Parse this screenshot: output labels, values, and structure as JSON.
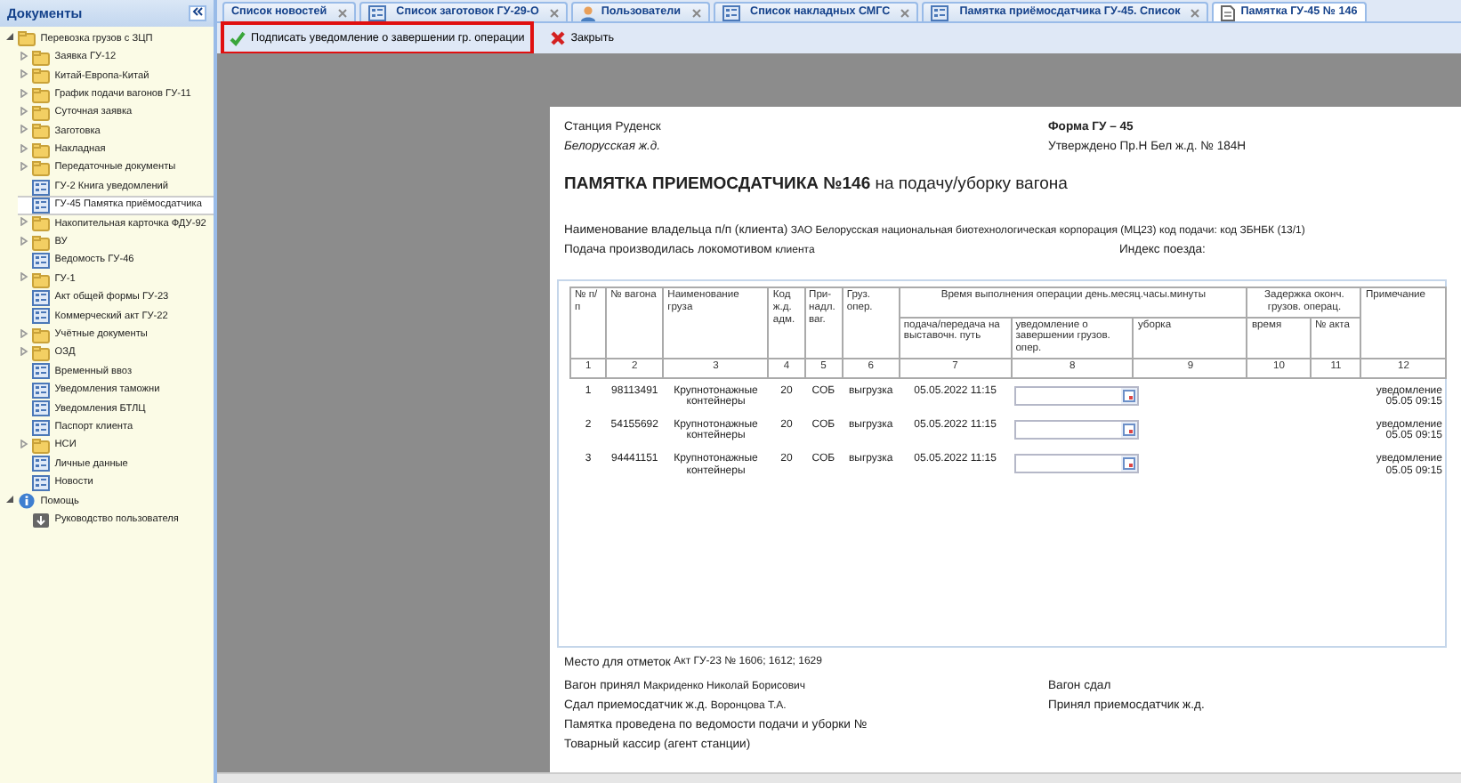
{
  "sidebar": {
    "title": "Документы",
    "items": [
      {
        "label": "Перевозка грузов с ЗЦП",
        "kind": "folder",
        "expanded": true,
        "selected": false,
        "children": [
          {
            "label": "Заявка ГУ-12",
            "kind": "folder",
            "expanded": false,
            "selected": false
          },
          {
            "label": "Китай-Европа-Китай",
            "kind": "folder",
            "expanded": false,
            "selected": false
          },
          {
            "label": "График подачи вагонов ГУ-11",
            "kind": "folder",
            "expanded": false,
            "selected": false
          },
          {
            "label": "Суточная заявка",
            "kind": "folder",
            "expanded": false,
            "selected": false
          },
          {
            "label": "Заготовка",
            "kind": "folder",
            "expanded": false,
            "selected": false
          },
          {
            "label": "Накладная",
            "kind": "folder",
            "expanded": false,
            "selected": false
          },
          {
            "label": "Передаточные документы",
            "kind": "folder",
            "expanded": false,
            "selected": false
          },
          {
            "label": "ГУ-2 Книга уведомлений",
            "kind": "document",
            "selected": false
          },
          {
            "label": "ГУ-45 Памятка приёмосдатчика",
            "kind": "document",
            "selected": true
          },
          {
            "label": "Накопительная карточка ФДУ-92",
            "kind": "folder",
            "expanded": false,
            "selected": false
          },
          {
            "label": "ВУ",
            "kind": "folder",
            "expanded": false,
            "selected": false
          },
          {
            "label": "Ведомость ГУ-46",
            "kind": "document",
            "selected": false
          },
          {
            "label": "ГУ-1",
            "kind": "folder",
            "expanded": false,
            "selected": false
          },
          {
            "label": "Акт общей формы ГУ-23",
            "kind": "document",
            "selected": false
          },
          {
            "label": "Коммерческий акт ГУ-22",
            "kind": "document",
            "selected": false
          },
          {
            "label": "Учётные документы",
            "kind": "folder",
            "expanded": false,
            "selected": false
          },
          {
            "label": "ОЗД",
            "kind": "folder",
            "expanded": false,
            "selected": false
          },
          {
            "label": "Временный ввоз",
            "kind": "document",
            "selected": false
          },
          {
            "label": "Уведомления таможни",
            "kind": "document",
            "selected": false
          },
          {
            "label": "Уведомления БТЛЦ",
            "kind": "document",
            "selected": false
          },
          {
            "label": "Паспорт клиента",
            "kind": "document",
            "selected": false
          },
          {
            "label": "НСИ",
            "kind": "folder",
            "expanded": false,
            "selected": false
          },
          {
            "label": "Личные данные",
            "kind": "document",
            "selected": false
          },
          {
            "label": "Новости",
            "kind": "document",
            "selected": false
          }
        ]
      },
      {
        "label": "Помощь",
        "kind": "info",
        "expanded": true,
        "selected": false,
        "children": [
          {
            "label": "Руководство пользователя",
            "kind": "download",
            "selected": false
          }
        ]
      }
    ]
  },
  "tabs": [
    {
      "label": "Список новостей",
      "kind": "plain",
      "selected": false
    },
    {
      "label": "Список заготовок ГУ-29-О",
      "kind": "list",
      "selected": false
    },
    {
      "label": "Пользователи",
      "kind": "users",
      "selected": false
    },
    {
      "label": "Список накладных СМГС",
      "kind": "list",
      "selected": false
    },
    {
      "label": "Памятка приёмосдатчика ГУ-45. Список",
      "kind": "list",
      "selected": false
    },
    {
      "label": "Памятка ГУ-45 № 146",
      "kind": "form",
      "selected": true
    }
  ],
  "toolbar": [
    {
      "label": "Подписать уведомление о завершении гр. операции",
      "kind": "sign",
      "highlighted": true
    },
    {
      "label": "Закрыть",
      "kind": "close",
      "highlighted": false
    }
  ],
  "document": {
    "station": "Станция Руденск",
    "form": "Форма ГУ – 45",
    "railway": "Белорусская ж.д.",
    "approved": "Утверждено Пр.Н Бел ж.д. № 184Н",
    "title": "**ПАМЯТКА ПРИЕМОСДАТЧИКА №146** на подачу/уборку вагона",
    "owner_label": "Наименование владельца п/п (клиента)",
    "owner_value": "ЗАО Белорусская национальная биотехнологическая корпорация (МЦ23)",
    "code_label": "код подачи:",
    "code_value": "код ЗБНБК (13/1)",
    "loco_label": "Подача производилась локомотивом",
    "loco_value": "клиента",
    "train_index_label": "Индекс поезда:",
    "table": {
      "header_top": [
        "№ п/п",
        "№ вагона",
        "Наименование груза",
        "Код ж.д. адм.",
        "При- надл. ваг.",
        "Груз. опер.",
        "Время выполнения операции день.месяц.часы.минуты",
        "Задержка оконч. грузов. операц.",
        "Примечание"
      ],
      "header_sub": [
        "подача/передача на выставочн. путь",
        "уведомление о завершении грузов. опер.",
        "уборка",
        "время",
        "№ акта"
      ],
      "numbers": [
        "1",
        "2",
        "3",
        "4",
        "5",
        "6",
        "7",
        "8",
        "9",
        "10",
        "11",
        "12"
      ],
      "rows": [
        {
          "n": "1",
          "wagon": "98113491",
          "cargo": "Крупнотонажные контейнеры",
          "code": "20",
          "owner": "СОБ",
          "operation": "выгрузка",
          "time": "05.05.2022 11:15",
          "note": "уведомление 05.05 09:15"
        },
        {
          "n": "2",
          "wagon": "54155692",
          "cargo": "Крупнотонажные контейнеры",
          "code": "20",
          "owner": "СОБ",
          "operation": "выгрузка",
          "time": "05.05.2022 11:15",
          "note": "уведомление 05.05 09:15"
        },
        {
          "n": "3",
          "wagon": "94441151",
          "cargo": "Крупнотонажные контейнеры",
          "code": "20",
          "owner": "СОБ",
          "operation": "выгрузка",
          "time": "05.05.2022 11:15",
          "note": "уведомление 05.05 09:15"
        }
      ]
    },
    "marks_label": "Место для отметок",
    "marks_value": "Акт ГУ-23 № 1606; 1612; 1629",
    "received_label": "Вагон принял",
    "received_value": "Макриденко Николай Борисович",
    "handed_label": "Вагон сдал",
    "gave_label": "Сдал приемосдатчик ж.д.",
    "gave_value": "Воронцова Т.А.",
    "took_label": "Принял приемосдатчик ж.д.",
    "statement": "Памятка проведена по ведомости подачи и уборки №",
    "cashier": "Товарный кассир (агент станции)"
  }
}
